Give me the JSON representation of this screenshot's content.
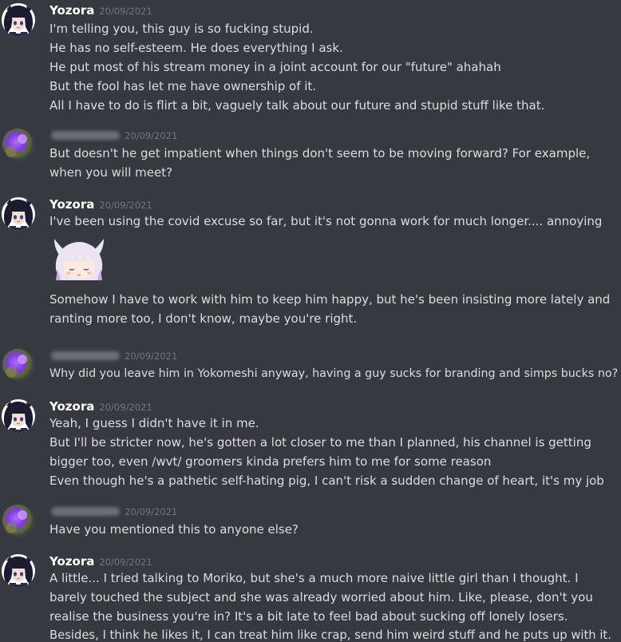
{
  "messages": [
    {
      "username": "Yozora",
      "timestamp": "20/09/2021",
      "lines": [
        "I'm telling you, this guy is so fucking stupid.",
        "He has no self-esteem. He does everything I ask.",
        "He put most of his stream money in a joint account for our \"future\" ahahah",
        "But the fool has let me have ownership of it.",
        "All I have to do is flirt a bit, vaguely talk about our future and stupid stuff like that."
      ]
    },
    {
      "username": "",
      "timestamp": "20/09/2021",
      "lines": [
        "But doesn't he get impatient when things don't seem to be moving forward? For example, when you will meet?"
      ]
    },
    {
      "username": "Yozora",
      "timestamp": "20/09/2021",
      "lines": [
        "I've been using the covid excuse so far, but it's not gonna work for much longer.... annoying"
      ],
      "lines_after_sticker": [
        "Somehow I have to work with him to keep him happy, but he's been insisting more lately and ranting more too, I don't know, maybe you're right."
      ]
    },
    {
      "username": "",
      "timestamp": "20/09/2021",
      "lines": [
        "Why did you leave him in Yokomeshi anyway, having a guy sucks for branding and simps bucks no?"
      ]
    },
    {
      "username": "Yozora",
      "timestamp": "20/09/2021",
      "lines": [
        "Yeah, I guess I didn't have it in me.",
        "But I'll be stricter now, he's gotten a lot closer to me than I planned, his channel is getting bigger too, even /wvt/ groomers kinda prefers him to me for some reason",
        "Even though he's a pathetic self-hating pig, I can't risk a sudden change of heart, it's my job"
      ]
    },
    {
      "username": "",
      "timestamp": "20/09/2021",
      "lines": [
        "Have you mentioned this to anyone else?"
      ]
    },
    {
      "username": "Yozora",
      "timestamp": "20/09/2021",
      "lines": [
        "A little... I tried talking to Moriko, but she's a much more naive little girl than I thought. I barely touched the subject and she was already worried about him. Like, please, don't you realise the business you're in? It's a bit late to feel bad about sucking off lonely losers.",
        "Besides, I think he likes it, I can treat him like crap, send him weird stuff and he puts up with it."
      ]
    }
  ],
  "icons": {
    "yozora_avatar": "anime-girl-avatar-icon",
    "other_avatar": "blurred-purple-avatar-icon",
    "sticker": "kanna-sticker-icon"
  },
  "colors": {
    "background": "#36393f",
    "username": "#ffffff",
    "timestamp": "#72767d",
    "text": "#dcddde"
  }
}
